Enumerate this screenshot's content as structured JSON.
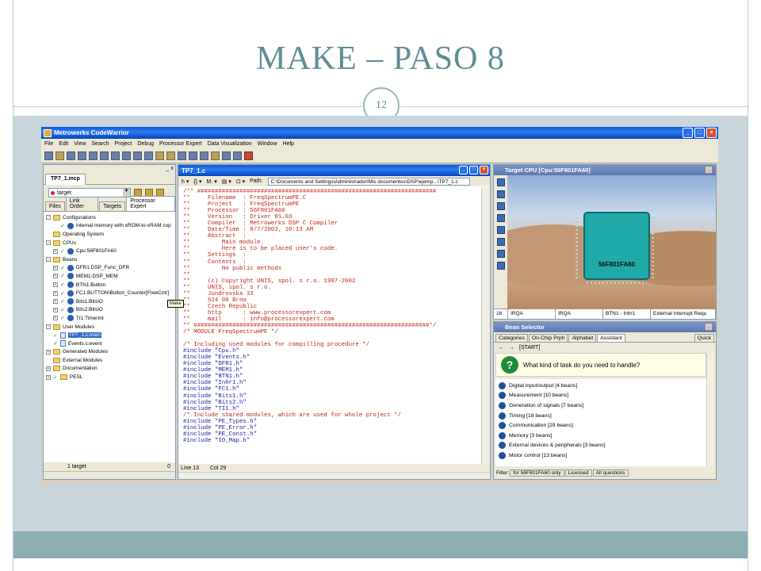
{
  "slide": {
    "title": "MAKE – PASO 8",
    "page_number": "12"
  },
  "app": {
    "title": "Metrowerks CodeWarrior",
    "window_controls": [
      "_",
      "□",
      "×"
    ],
    "menu": [
      "File",
      "Edit",
      "View",
      "Search",
      "Project",
      "Debug",
      "Processor Expert",
      "Data Visualization",
      "Window",
      "Help"
    ]
  },
  "project": {
    "tab": "TP7_1.mcp",
    "close_controls": "_ x",
    "target": "target",
    "tabs": [
      "Files",
      "Link Order",
      "Targets",
      "Processor Expert"
    ],
    "tooltip": "Make",
    "tree": [
      {
        "toggle": "-",
        "icon": "folder",
        "label": "Configurations"
      },
      {
        "indent": 2,
        "check": "✓",
        "icon": "bean",
        "label": "internal memory with xROM-to-xRAM cop"
      },
      {
        "indent": 1,
        "icon": "folder",
        "label": "Operating System"
      },
      {
        "toggle": "-",
        "icon": "folder",
        "label": "CPUs"
      },
      {
        "indent": 1,
        "toggle": "+",
        "check": "✓",
        "icon": "bean",
        "label": "Cpu:56F801FA60"
      },
      {
        "toggle": "-",
        "icon": "folder",
        "label": "Beans"
      },
      {
        "indent": 1,
        "toggle": "+",
        "check": "✓",
        "icon": "bean",
        "label": "DFR1:DSP_Func_DFR"
      },
      {
        "indent": 1,
        "toggle": "+",
        "check": "✓",
        "icon": "bean",
        "label": "MEM1:DSP_MEM"
      },
      {
        "indent": 1,
        "toggle": "+",
        "check": "✓",
        "icon": "bean",
        "label": "BTN1:Button"
      },
      {
        "indent": 1,
        "toggle": "+",
        "check": "✓",
        "icon": "bean",
        "label": "FC1:BUTTON\\Button_Counter[FreeCntr]"
      },
      {
        "indent": 1,
        "toggle": "+",
        "check": "✓",
        "icon": "bean",
        "label": "Bits1:BitsIO"
      },
      {
        "indent": 1,
        "toggle": "+",
        "check": "✓",
        "icon": "bean",
        "label": "Bits2:BitsIO"
      },
      {
        "indent": 1,
        "toggle": "+",
        "check": "✓",
        "icon": "bean",
        "label": "TI1:TimerInt"
      },
      {
        "toggle": "-",
        "icon": "folder",
        "label": "User Modules"
      },
      {
        "indent": 1,
        "check": "✓",
        "icon": "file",
        "label": "TP7_1.c:main",
        "selected": true
      },
      {
        "indent": 1,
        "check": "✓",
        "icon": "file",
        "label": "Events.c:event"
      },
      {
        "toggle": "+",
        "icon": "folder",
        "label": "Generated Modules"
      },
      {
        "indent": 1,
        "icon": "folder",
        "label": "External Modules"
      },
      {
        "toggle": "+",
        "icon": "folder",
        "label": "Documentation"
      },
      {
        "toggle": "+",
        "check": "✓",
        "icon": "folder",
        "label": "PESL"
      }
    ],
    "status_left": "1 target",
    "status_right": "0"
  },
  "editor": {
    "title": "TP7_1.c",
    "toolbar": [
      "h ▾",
      "{} ▾",
      "M. ▾",
      "▤ ▾",
      "⊡ ▾"
    ],
    "path_label": "Path:",
    "path": "C:\\Documents and Settings\\Administrador\\Mis documentos\\DSP\\ejemp...\\TP7_1.c",
    "code": [
      [
        "c",
        "/** ####################################################################"
      ],
      [
        "c",
        "**     Filename  : FreqSpectrumPE.C"
      ],
      [
        "c",
        "**     Project   : FreqSpectrumPE"
      ],
      [
        "c",
        "**     Processor : 56F801FA60"
      ],
      [
        "c",
        "**     Version   : Driver 01.03"
      ],
      [
        "c",
        "**     Compiler  : Metrowerks DSP C Compiler"
      ],
      [
        "c",
        "**     Date/Time : 8/7/2003, 10:13 AM"
      ],
      [
        "c",
        "**     Abstract  :"
      ],
      [
        "c",
        "**         Main module."
      ],
      [
        "c",
        "**         Here is to be placed user's code."
      ],
      [
        "c",
        "**     Settings  :"
      ],
      [
        "c",
        "**     Contents  :"
      ],
      [
        "c",
        "**         No public methods"
      ],
      [
        "c",
        "**"
      ],
      [
        "c",
        "**     (c) Copyright UNIS, spol. s r.o. 1997-2002"
      ],
      [
        "c",
        "**     UNIS, spol. s r.o."
      ],
      [
        "c",
        "**     Jundrovska 33"
      ],
      [
        "c",
        "**     624 00 Brno"
      ],
      [
        "c",
        "**     Czech Republic"
      ],
      [
        "c",
        "**     http      : www.processorexpert.com"
      ],
      [
        "c",
        "**     mail      : info@processorexpert.com"
      ],
      [
        "c",
        "** ###################################################################*/"
      ],
      [
        "c",
        "/* MODULE FreqSpectrumPE */"
      ],
      [
        "n",
        ""
      ],
      [
        "c",
        "/* Including used modules for compilling procedure */"
      ],
      [
        "p",
        "#include \"Cpu.h\""
      ],
      [
        "p",
        "#include \"Events.h\""
      ],
      [
        "p",
        "#include \"DFR1.h\""
      ],
      [
        "p",
        "#include \"MEM1.h\""
      ],
      [
        "p",
        "#include \"BTN1.h\""
      ],
      [
        "p",
        "#include \"Inhr1.h\""
      ],
      [
        "p",
        "#include \"FC1.h\""
      ],
      [
        "p",
        "#include \"Bits1.h\""
      ],
      [
        "p",
        "#include \"Bits2.h\""
      ],
      [
        "p",
        "#include \"TI1.h\""
      ],
      [
        "c",
        "/* Include shared modules, which are used for whole project */"
      ],
      [
        "p",
        "#include \"PE_Types.h\""
      ],
      [
        "p",
        "#include \"PE_Error.h\""
      ],
      [
        "p",
        "#include \"PE_Const.h\""
      ],
      [
        "p",
        "#include \"IO_Map.h\""
      ]
    ],
    "status_line": "Line 13",
    "status_col": "Col 29"
  },
  "cpu": {
    "title": "Target CPU [Cpu:56F801FA60]",
    "chip_label": "56F801FA60",
    "min_btn": "_",
    "bar": [
      "16",
      "IRQA",
      "IRQA",
      "BTN1 - Inhr1",
      "External Interrupt Requ"
    ]
  },
  "beans": {
    "title": "Bean Selector",
    "min_btn": "_",
    "tabs": [
      "Categories",
      "On-Chip Prph",
      "Alphabet",
      "Assistant"
    ],
    "active_tab": "Assistant",
    "right_tab": "Quick",
    "nav_back": "←",
    "nav_forward": "→",
    "start": "[START]",
    "question_icon": "?",
    "question": "What kind of task do you need to handle?",
    "items": [
      "Digital input/output  [4 beans]",
      "Measurement  [10 beans]",
      "Generation of signals  [7 beans]",
      "Timing  [18 beans]",
      "Communication  [29 beans]",
      "Memory  [3 beans]",
      "External devices & peripherals  [3 beans]",
      "Motor control  [13 beans]"
    ],
    "filter": [
      "Filter:",
      "for 56F801FA60 only",
      "Licensed",
      "All questions"
    ]
  }
}
